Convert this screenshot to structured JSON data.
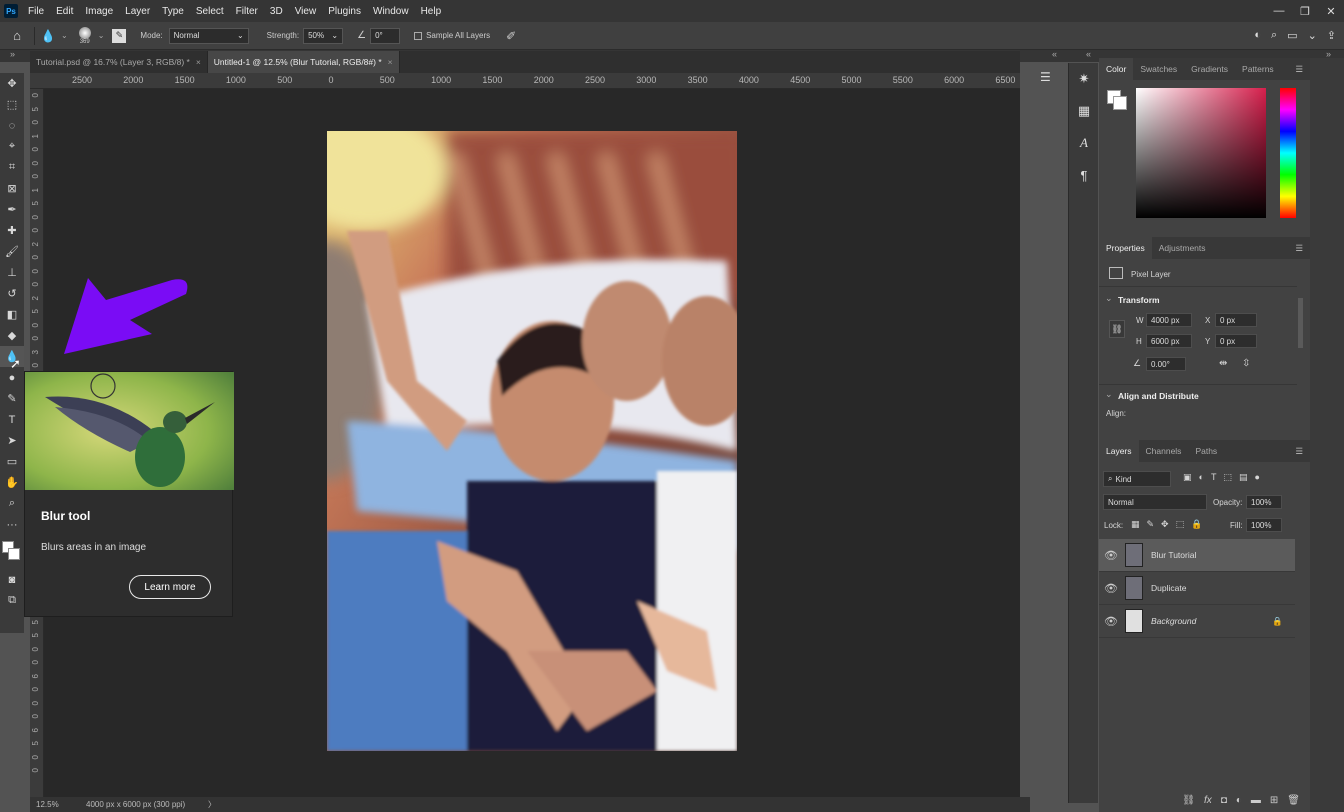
{
  "menubar": {
    "items": [
      "File",
      "Edit",
      "Image",
      "Layer",
      "Type",
      "Select",
      "Filter",
      "3D",
      "View",
      "Plugins",
      "Window",
      "Help"
    ],
    "window_controls": [
      "—",
      "❐",
      "✕"
    ]
  },
  "options": {
    "brush_size": "369",
    "mode_label": "Mode:",
    "mode_value": "Normal",
    "strength_label": "Strength:",
    "strength_value": "50%",
    "angle_value": "0°",
    "sample_all_layers": "Sample All Layers"
  },
  "tabs": [
    {
      "label": "Tutorial.psd @ 16.7% (Layer 3, RGB/8) *",
      "close": "×"
    },
    {
      "label": "Untitled-1 @ 12.5% (Blur Tutorial, RGB/8#) *",
      "close": "×"
    }
  ],
  "ruler_top": [
    "2500",
    "2000",
    "1500",
    "1000",
    "500",
    "0",
    "500",
    "1000",
    "1500",
    "2000",
    "2500",
    "3000",
    "3500",
    "4000",
    "4500",
    "5000",
    "5500",
    "6000",
    "6500"
  ],
  "ruler_left": [
    "0",
    "5",
    "0",
    "1",
    "0",
    "0",
    "0",
    "1",
    "5",
    "0",
    "0",
    "2",
    "0",
    "0",
    "0",
    "2",
    "5",
    "0",
    "0",
    "3",
    "0",
    "0",
    "0",
    "3",
    "5",
    "0",
    "0",
    "4",
    "0",
    "0",
    "0",
    "4",
    "5",
    "0",
    "0",
    "5",
    "0",
    "0",
    "0",
    "5",
    "5",
    "0",
    "0",
    "6",
    "0",
    "0",
    "0",
    "6",
    "5",
    "0",
    "0"
  ],
  "tooltip": {
    "title": "Blur tool",
    "description": "Blurs areas in an image",
    "button": "Learn more"
  },
  "status": {
    "zoom": "12.5%",
    "doc_info": "4000 px x 6000 px (300 ppi)",
    "arrow": "〉"
  },
  "color_panel": {
    "tabs": [
      "Color",
      "Swatches",
      "Gradients",
      "Patterns"
    ]
  },
  "properties": {
    "tabs": [
      "Properties",
      "Adjustments"
    ],
    "layer_type": "Pixel Layer",
    "transform_title": "Transform",
    "w_label": "W",
    "w_value": "4000 px",
    "x_label": "X",
    "x_value": "0 px",
    "h_label": "H",
    "h_value": "6000 px",
    "y_label": "Y",
    "y_value": "0 px",
    "angle_value": "0.00°",
    "align_title": "Align and Distribute",
    "align_label": "Align:"
  },
  "layers_panel": {
    "tabs": [
      "Layers",
      "Channels",
      "Paths"
    ],
    "kind": "Kind",
    "blend": "Normal",
    "opacity_label": "Opacity:",
    "opacity_value": "100%",
    "lock_label": "Lock:",
    "fill_label": "Fill:",
    "fill_value": "100%",
    "layers": [
      {
        "name": "Blur Tutorial"
      },
      {
        "name": "Duplicate"
      },
      {
        "name": "Background"
      }
    ]
  },
  "colors": {
    "arrow": "#7a0cf5",
    "accent_red": "#d61f4c"
  }
}
